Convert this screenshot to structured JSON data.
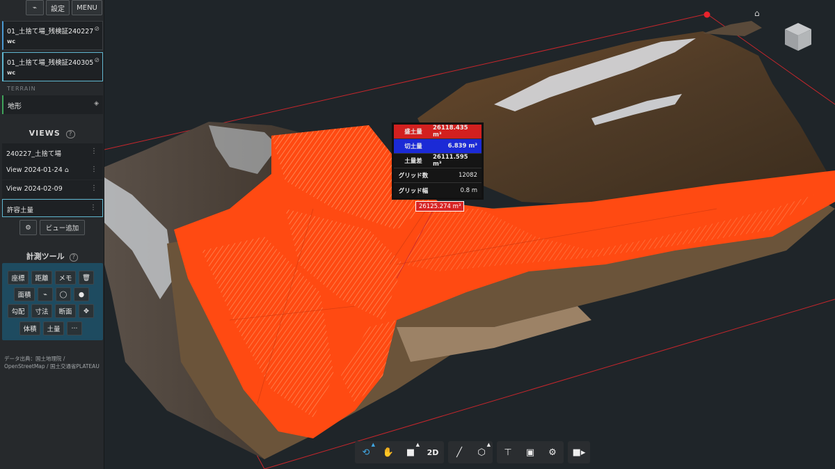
{
  "toolbar_top": {
    "chart_btn": "⌁",
    "settings": "設定",
    "menu": "MENU"
  },
  "files": [
    {
      "name": "01_土捨て場_残検証240227.n",
      "ext": "wc"
    },
    {
      "name": "01_土捨て場_残検証240305.n",
      "ext": "wc"
    }
  ],
  "terrain": {
    "section": "TERRAIN",
    "item": "地形"
  },
  "views": {
    "title": "VIEWS",
    "help": "?",
    "items": [
      "240227_土捨て場",
      "View 2024-01-24",
      "View 2024-02-09",
      "許容土量"
    ],
    "add_view": "ビュー追加"
  },
  "tools": {
    "title": "計測ツール",
    "help": "?",
    "buttons": [
      "座標",
      "距離",
      "メモ",
      "面積",
      "勾配",
      "寸法",
      "断面",
      "体積",
      "土量",
      "···"
    ]
  },
  "attribution": "データ出典：国土地理院 / OpenStreetMap / 国土交通省PLATEAU",
  "volume_popup": {
    "rows": [
      {
        "key": "盛土量",
        "value": "26118.435 m³",
        "style": "fill"
      },
      {
        "key": "切土量",
        "value": "6.839 m³",
        "style": "cut"
      },
      {
        "key": "土量差",
        "value": "26111.595 m³",
        "style": "net"
      },
      {
        "key": "グリッド数",
        "value": "12082",
        "style": "plain"
      },
      {
        "key": "グリッド幅",
        "value": "0.8 m",
        "style": "plain"
      }
    ],
    "label": "26125.274 m³"
  },
  "bottom_toolbar": {
    "mode_2d": "2D"
  },
  "colors": {
    "fill": "#d2201f",
    "cut": "#1b2ad6",
    "volume_surface": "#ff4a12",
    "accent": "#40a8e4"
  }
}
